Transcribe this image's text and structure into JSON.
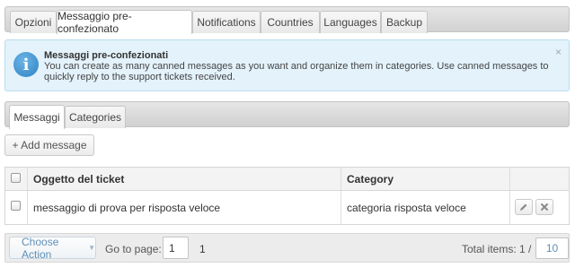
{
  "tabs": [
    {
      "label": "Opzioni"
    },
    {
      "label": "Messaggio pre-confezionato",
      "active": true
    },
    {
      "label": "Notifications"
    },
    {
      "label": "Countries"
    },
    {
      "label": "Languages"
    },
    {
      "label": "Backup"
    }
  ],
  "alert": {
    "icon": "info-icon",
    "title": "Messaggi pre-confezionati",
    "text": "You can create as many canned messages as you want and organize them in categories. Use canned messages to quickly reply to the support tickets received.",
    "close": "×"
  },
  "subtabs": [
    {
      "label": "Messaggi",
      "active": true
    },
    {
      "label": "Categories"
    }
  ],
  "toolbar": {
    "add_label": "+ Add message"
  },
  "table": {
    "headers": {
      "subject": "Oggetto del ticket",
      "category": "Category"
    },
    "rows": [
      {
        "subject": "messaggio di prova per risposta veloce",
        "category": "categoria risposta veloce"
      }
    ]
  },
  "footer": {
    "choose_action": "Choose Action",
    "goto_label": "Go to page:",
    "page_value": "1",
    "page_total": "1",
    "total_label": "Total items: 1 /",
    "page_size": "10"
  },
  "colors": {
    "accent": "#5f8fb8",
    "info_blue": "#2f82c3",
    "alert_bg": "#e3f2fb"
  }
}
